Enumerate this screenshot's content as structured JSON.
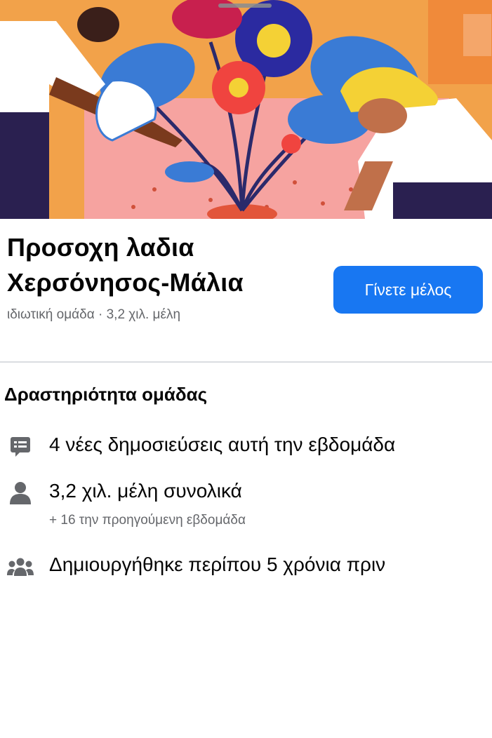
{
  "group": {
    "name_line1": "Προσοχη λαδια",
    "name_line2": "Χερσόνησος-Μάλια",
    "meta": "ιδιωτική ομάδα · 3,2 χιλ. μέλη",
    "join_label": "Γίνετε μέλος",
    "accent_color": "#1877f2"
  },
  "activity": {
    "title": "Δραστηριότητα ομάδας",
    "rows": [
      {
        "icon": "posts-icon",
        "text": "4 νέες δημοσιεύσεις αυτή την εβδομάδα"
      },
      {
        "icon": "person-icon",
        "text": "3,2 χιλ. μέλη συνολικά",
        "subtext": "+ 16 την προηγούμενη εβδομάδα"
      },
      {
        "icon": "group-icon",
        "text": "Δημιουργήθηκε περίπου 5 χρόνια πριν"
      }
    ]
  }
}
